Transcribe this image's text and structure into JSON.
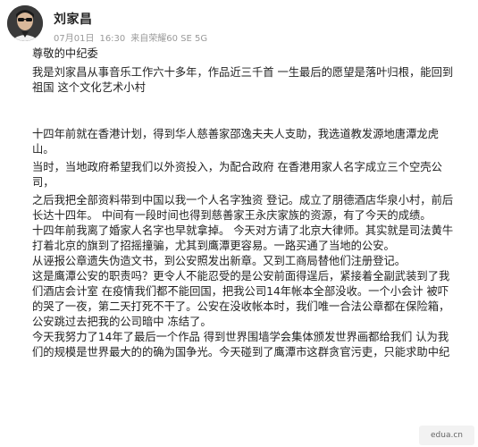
{
  "header": {
    "author": "刘家昌",
    "date": "07月01日",
    "time": "16:30",
    "source": "来自",
    "device": "荣耀60 SE 5G"
  },
  "post": {
    "salutation": "尊敬的中纪委",
    "intro_lines": [
      "我是刘家昌从事音乐工作六十多年，作品近三千首 一生最后的愿望是落叶归根，能回到",
      "祖国 这个文化艺术小村"
    ],
    "story_lines": [
      "十四年前就在香港计划，得到华人慈善家邵逸夫夫人支助，我选道教发源地唐潭龙虎",
      "山。",
      "当时，当地政府希望我们以外资投入，为配合政府 在香港用家人名字成立三个空壳公",
      "司，",
      "之后我把全部资料带到中国以我一个人名字独资 登记。成立了朋德酒店华泉小村，前后",
      "长达十四年。 中间有一段时间也得到慈善家王永庆家族的资源，有了今天的成绩。",
      "十四年前我离了婚家人名字也早就拿掉。 今天对方请了北京大律师。其实就是司法黄牛",
      "打着北京的旗到了招摇撞骗，尤其到鹰潭更容易。一路买通了当地的公安。",
      "从诬报公章遗失伪造文书，到公安照发出新章。又到工商局替他们注册登记。",
      "这是鹰潭公安的职责吗？更令人不能忍受的是公安前面得逞后，紧接着全副武装到了我",
      "们酒店会计室 在疫情我们都不能回国，把我公司14年帐本全部没收。一个小会计 被吓",
      "的哭了一夜，第二天打死不干了。公安在没收帐本时，我们唯一合法公章都在保险箱，",
      "公安跳过去把我的公司暗中 冻结了。",
      "今天我努力了14年了最后一个作品 得到世界围墙学会集体颁发世界画都给我们 认为我",
      "们的规模是世界最大的的确为国争光。今天碰到了鹰潭市这群贪官污吏，只能求助中纪"
    ]
  },
  "watermark": {
    "text": "edua.cn"
  }
}
